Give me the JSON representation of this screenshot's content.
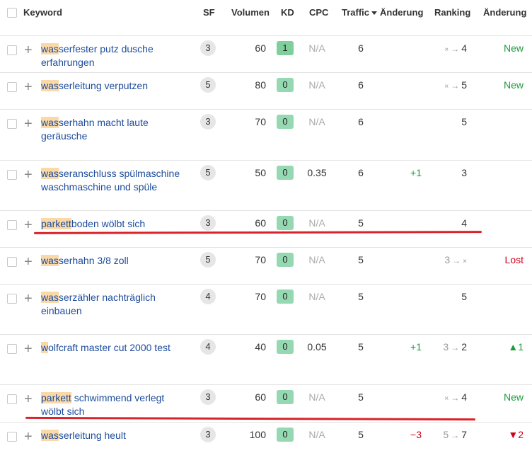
{
  "columns": {
    "keyword": "Keyword",
    "sf": "SF",
    "volume": "Volumen",
    "kd": "KD",
    "cpc": "CPC",
    "traffic": "Traffic",
    "traffic_change": "Änderung",
    "ranking": "Ranking",
    "ranking_change": "Änderung"
  },
  "rows": [
    {
      "hl": "was",
      "rest": "serfester putz dusche",
      "line2": "erfahrungen",
      "sf": "3",
      "volume": "60",
      "kd": "1",
      "cpc": "N/A",
      "traffic": "6",
      "tchange": "",
      "rank_prev": "×",
      "rank_now": "4",
      "rchange": "New"
    },
    {
      "hl": "was",
      "rest": "serleitung verputzen",
      "line2": "",
      "sf": "5",
      "volume": "80",
      "kd": "0",
      "cpc": "N/A",
      "traffic": "6",
      "tchange": "",
      "rank_prev": "×",
      "rank_now": "5",
      "rchange": "New"
    },
    {
      "hl": "was",
      "rest": "serhahn macht laute",
      "line2": "geräusche",
      "sf": "3",
      "volume": "70",
      "kd": "0",
      "cpc": "N/A",
      "traffic": "6",
      "tchange": "",
      "rank_prev": "",
      "rank_now": "5",
      "rchange": ""
    },
    {
      "hl": "was",
      "rest": "seranschluss spülmaschine",
      "line2": "waschmaschine und spüle",
      "sf": "5",
      "volume": "50",
      "kd": "0",
      "cpc": "0.35",
      "traffic": "6",
      "tchange": "+1",
      "rank_prev": "",
      "rank_now": "3",
      "rchange": ""
    },
    {
      "hl": "parkett",
      "rest": "boden wölbt sich",
      "line2": "",
      "sf": "3",
      "volume": "60",
      "kd": "0",
      "cpc": "N/A",
      "traffic": "5",
      "tchange": "",
      "rank_prev": "",
      "rank_now": "4",
      "rchange": ""
    },
    {
      "hl": "was",
      "rest": "serhahn 3/8 zoll",
      "line2": "",
      "sf": "5",
      "volume": "70",
      "kd": "0",
      "cpc": "N/A",
      "traffic": "5",
      "tchange": "",
      "rank_prev": "3",
      "rank_now": "×",
      "rchange": "Lost"
    },
    {
      "hl": "was",
      "rest": "serzähler nachträglich",
      "line2": "einbauen",
      "sf": "4",
      "volume": "70",
      "kd": "0",
      "cpc": "N/A",
      "traffic": "5",
      "tchange": "",
      "rank_prev": "",
      "rank_now": "5",
      "rchange": ""
    },
    {
      "hl": "w",
      "rest": "olfcraft master cut 2000 test",
      "line2": "",
      "sf": "4",
      "volume": "40",
      "kd": "0",
      "cpc": "0.05",
      "traffic": "5",
      "tchange": "+1",
      "rank_prev": "3",
      "rank_now": "2",
      "rchange": "▲1"
    },
    {
      "hl": "parkett",
      "rest": " schwimmend verlegt",
      "line2": "wölbt sich",
      "sf": "3",
      "volume": "60",
      "kd": "0",
      "cpc": "N/A",
      "traffic": "5",
      "tchange": "",
      "rank_prev": "×",
      "rank_now": "4",
      "rchange": "New"
    },
    {
      "hl": "was",
      "rest": "serleitung heult",
      "line2": "",
      "sf": "3",
      "volume": "100",
      "kd": "0",
      "cpc": "N/A",
      "traffic": "5",
      "tchange": "−3",
      "rank_prev": "5",
      "rank_now": "7",
      "rchange": "▼2"
    }
  ]
}
